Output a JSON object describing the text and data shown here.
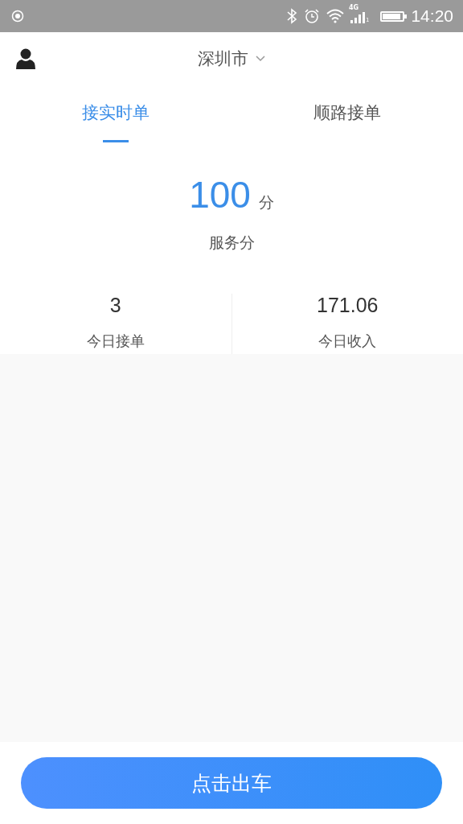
{
  "status_bar": {
    "network": "4G",
    "sim": "1",
    "time": "14:20"
  },
  "header": {
    "city": "深圳市"
  },
  "tabs": [
    {
      "label": "接实时单",
      "selected": true
    },
    {
      "label": "顺路接单",
      "selected": false
    }
  ],
  "score": {
    "value": "100",
    "unit": "分",
    "label": "服务分"
  },
  "stats": [
    {
      "value": "3",
      "label": "今日接单"
    },
    {
      "value": "171.06",
      "label": "今日收入"
    }
  ],
  "action_button": "点击出车"
}
